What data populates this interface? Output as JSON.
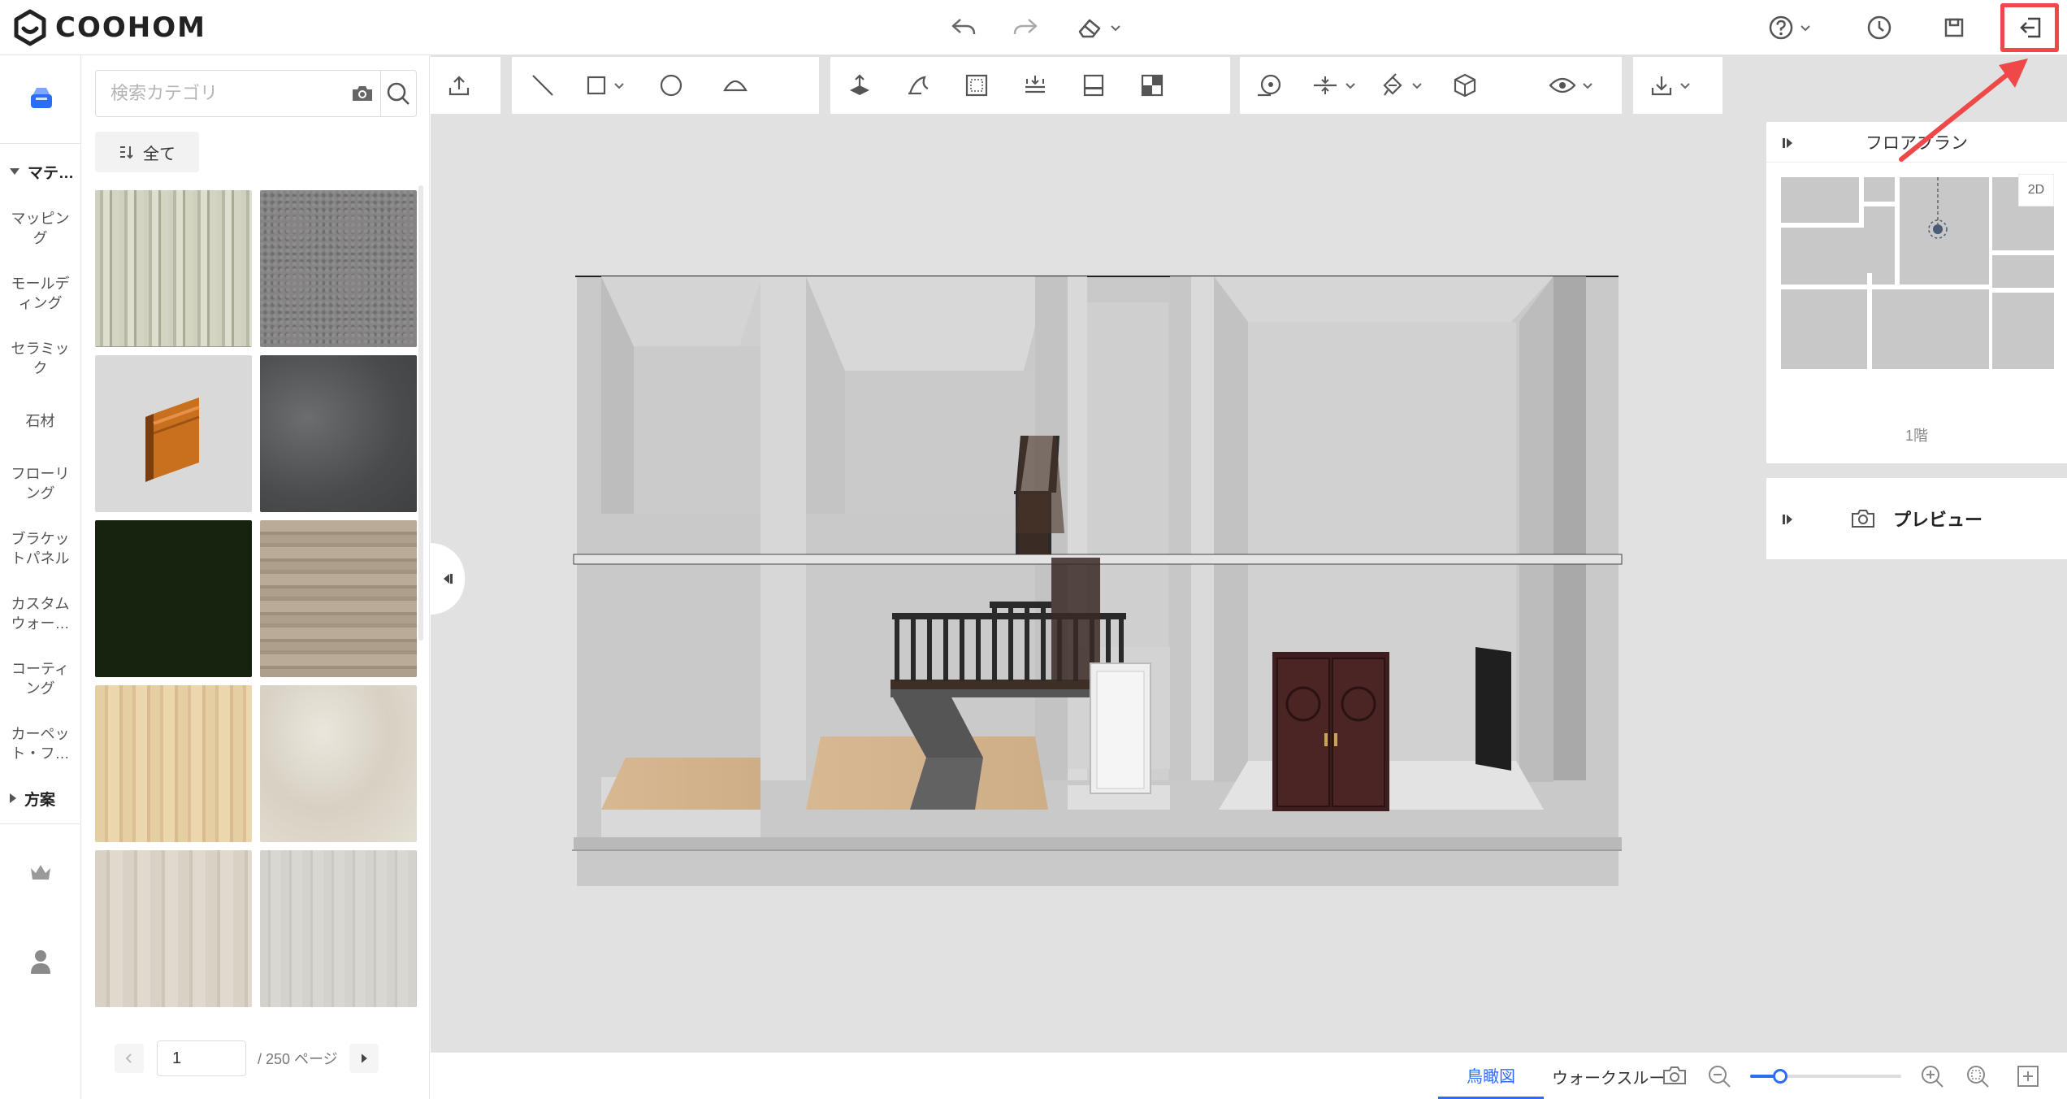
{
  "brand": {
    "name": "COOHOM",
    "accent": "#2d6df6",
    "highlight": "#f04848"
  },
  "header": {
    "buttons": [
      {
        "name": "undo-icon"
      },
      {
        "name": "redo-icon"
      },
      {
        "name": "eraser-icon"
      },
      {
        "name": "help-icon"
      },
      {
        "name": "history-icon"
      },
      {
        "name": "save-icon"
      },
      {
        "name": "exit-icon"
      }
    ]
  },
  "rail": {
    "section_material": "マテ…",
    "items": [
      "マッピング",
      "モールディング",
      "セラミック",
      "石材",
      "フローリング",
      "ブラケットパネル",
      "カスタムウォー…",
      "コーティング",
      "カーペット・フ…"
    ],
    "section_plan": "方案"
  },
  "materials": {
    "search_placeholder": "検索カテゴリ",
    "all_label": "全て",
    "tiles": [
      {
        "kind": "wood-light-stripe"
      },
      {
        "kind": "carpet-gray"
      },
      {
        "kind": "molding"
      },
      {
        "kind": "concrete-dark"
      },
      {
        "kind": "dark-green"
      },
      {
        "kind": "wood-ash"
      },
      {
        "kind": "wood-maple"
      },
      {
        "kind": "marble-cream"
      },
      {
        "kind": "wood-pale"
      },
      {
        "kind": "wood-pale-gray"
      }
    ],
    "pager": {
      "current": "1",
      "total": "/ 250 ページ"
    }
  },
  "toolbar": {
    "groups": [
      [
        "upload-icon"
      ],
      [
        "line-icon",
        "rect-icon",
        "circle-icon",
        "arc-icon"
      ],
      [
        "move-up-icon",
        "sculpt-icon",
        "frame-icon",
        "level-icon",
        "panel-icon",
        "split-icon"
      ],
      [
        "measure-icon",
        "align-icon",
        "paint-icon",
        "cube-icon"
      ],
      [
        "eye-icon"
      ],
      [
        "download-icon"
      ]
    ]
  },
  "floorplan": {
    "title": "フロアプラン",
    "mode": "2D",
    "floor": "1階"
  },
  "preview": {
    "label": "プレビュー"
  },
  "bottom": {
    "tab_aerial": "鳥瞰図",
    "tab_walk": "ウォークスルー",
    "zoom": 0.2
  }
}
